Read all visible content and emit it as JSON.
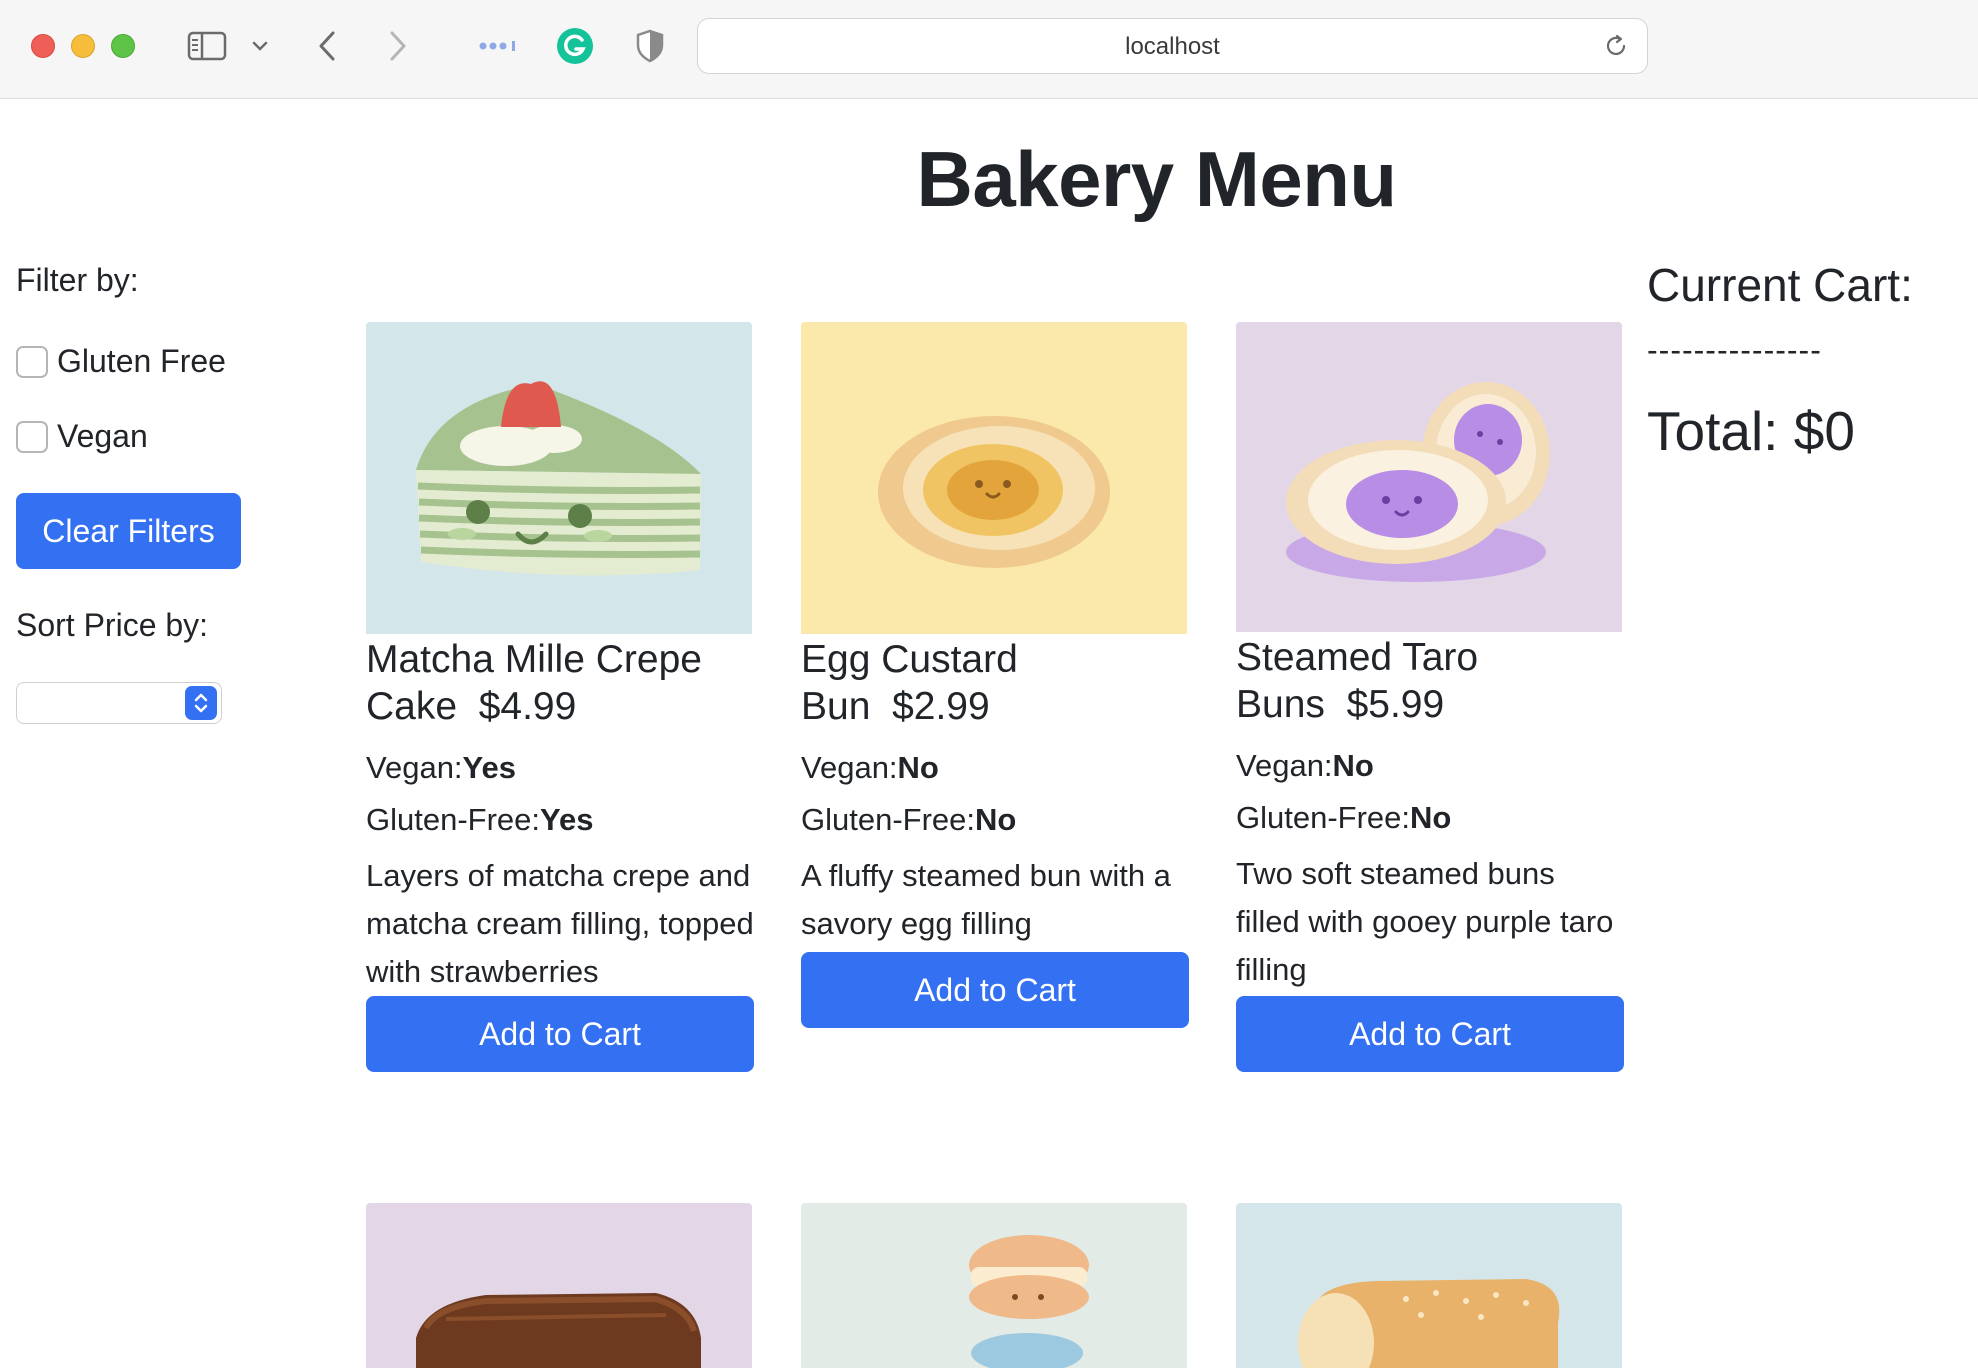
{
  "browser": {
    "url": "localhost"
  },
  "page": {
    "title": "Bakery Menu"
  },
  "sidebar": {
    "filter_heading": "Filter by:",
    "filters": [
      {
        "label": "Gluten Free",
        "checked": false
      },
      {
        "label": "Vegan",
        "checked": false
      }
    ],
    "clear_label": "Clear Filters",
    "sort_heading": "Sort Price by:",
    "sort_selected": ""
  },
  "products": [
    {
      "name": "Matcha Mille Crepe Cake",
      "price": "$4.99",
      "vegan_label": "Vegan:",
      "vegan": "Yes",
      "gluten_label": "Gluten-Free:",
      "gluten_free": "Yes",
      "description": "Layers of matcha crepe and matcha cream filling, topped with strawberries",
      "button": "Add to Cart",
      "bg_color": "#d3e6ea"
    },
    {
      "name": "Egg Custard Bun",
      "price": "$2.99",
      "vegan_label": "Vegan:",
      "vegan": "No",
      "gluten_label": "Gluten-Free:",
      "gluten_free": "No",
      "description": "A fluffy steamed bun with a savory egg filling",
      "button": "Add to Cart",
      "bg_color": "#fbe9ab"
    },
    {
      "name": "Steamed Taro Buns",
      "price": "$5.99",
      "vegan_label": "Vegan:",
      "vegan": "No",
      "gluten_label": "Gluten-Free:",
      "gluten_free": "No",
      "description": "Two soft steamed buns filled with gooey purple taro filling",
      "button": "Add to Cart",
      "bg_color": "#e3d6e6"
    }
  ],
  "products_row2": [
    {
      "bg_color": "#e3d6e6"
    },
    {
      "bg_color": "#e2ebe6"
    },
    {
      "bg_color": "#d5e6ea"
    }
  ],
  "cart": {
    "heading": "Current Cart:",
    "divider": "---------------",
    "total": "Total: $0"
  },
  "theme": {
    "primary": "#3370f2",
    "text": "#212529"
  }
}
